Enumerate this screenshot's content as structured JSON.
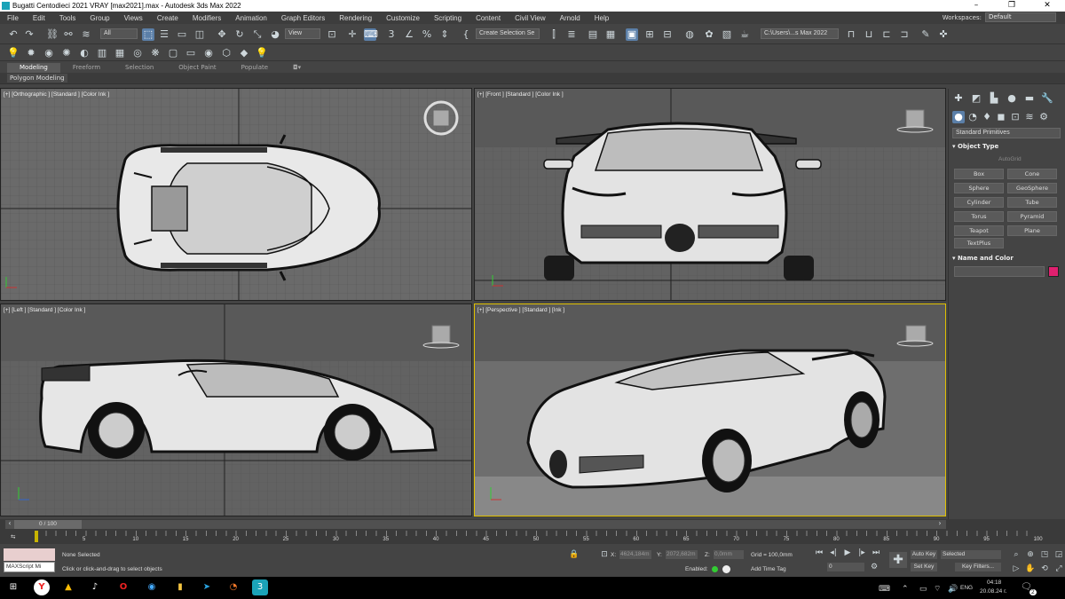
{
  "window": {
    "title": "Bugatti Centodieci 2021 VRAY [max2021].max - Autodesk 3ds Max 2022",
    "minimize": "–",
    "maximize": "❐",
    "close": "✕"
  },
  "menu": [
    "File",
    "Edit",
    "Tools",
    "Group",
    "Views",
    "Create",
    "Modifiers",
    "Animation",
    "Graph Editors",
    "Rendering",
    "Customize",
    "Scripting",
    "Content",
    "Civil View",
    "Arnold",
    "Help"
  ],
  "workspace": {
    "label": "Workspaces:",
    "value": "Default"
  },
  "toolbar": {
    "filter": "All",
    "refcoord": "View",
    "selset": "Create Selection Se",
    "path": "C:\\Users\\...s Max 2022"
  },
  "ribbon": {
    "tabs": [
      "Modeling",
      "Freeform",
      "Selection",
      "Object Paint",
      "Populate"
    ],
    "panel": "Polygon Modeling"
  },
  "viewports": [
    {
      "label": "[+] [Orthographic ] [Standard ] [Color Ink ]"
    },
    {
      "label": "[+] [Front ] [Standard ] [Color Ink ]"
    },
    {
      "label": "[+] [Left ] [Standard ] [Color Ink ]"
    },
    {
      "label": "[+] [Perspective ] [Standard ] [Ink ]"
    }
  ],
  "cmdpanel": {
    "category": "Standard Primitives",
    "objtype": "Object Type",
    "autogrid": "AutoGrid",
    "buttons": [
      "Box",
      "Cone",
      "Sphere",
      "GeoSphere",
      "Cylinder",
      "Tube",
      "Torus",
      "Pyramid",
      "Teapot",
      "Plane",
      "TextPlus"
    ],
    "namecolor": "Name and Color",
    "color": "#e0206f"
  },
  "timeline": {
    "range": "0 / 100",
    "ticks": [
      "5",
      "10",
      "15",
      "20",
      "25",
      "30",
      "35",
      "40",
      "45",
      "50",
      "55",
      "60",
      "65",
      "70",
      "75",
      "80",
      "85",
      "90",
      "95",
      "100"
    ]
  },
  "status": {
    "script": "MAXScript Mi",
    "selected": "None Selected",
    "prompt": "Click or click-and-drag to select objects",
    "x": "X: ",
    "xv": "4624,184m",
    "y": "Y: ",
    "yv": "2072,682m",
    "z": "Z: ",
    "zv": "0,0mm",
    "grid": "Grid = 100,0mm",
    "enabled": "Enabled:",
    "addtimetag": "Add Time Tag",
    "autokey": "Auto Key",
    "setkey": "Set Key",
    "selected2": "Selected",
    "keyfilters": "Key Filters...",
    "frame": "0"
  },
  "taskbar": {
    "lang": "ENG",
    "time": "04:18",
    "date": "20.08.24 г.",
    "notif": "2"
  }
}
